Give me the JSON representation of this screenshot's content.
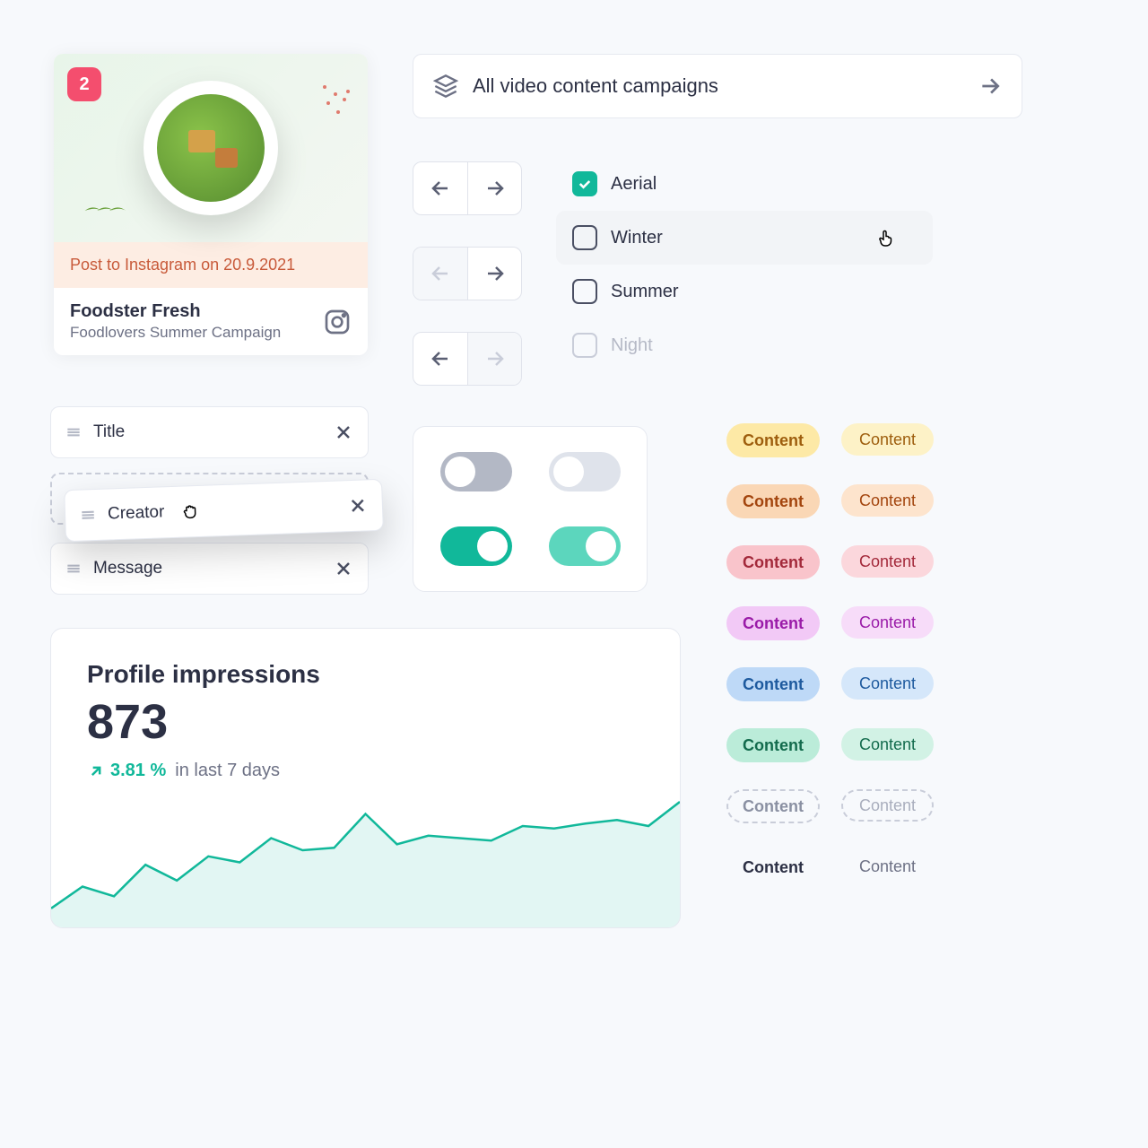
{
  "post": {
    "badge": "2",
    "banner": "Post to Instagram on 20.9.2021",
    "title": "Foodster Fresh",
    "subtitle": "Foodlovers Summer Campaign"
  },
  "campaign_bar": "All video content campaigns",
  "checks": {
    "aerial": "Aerial",
    "winter": "Winter",
    "summer": "Summer",
    "night": "Night"
  },
  "drag": {
    "title": "Title",
    "creator": "Creator",
    "message": "Message"
  },
  "stat": {
    "title": "Profile impressions",
    "value": "873",
    "trend": "3.81 %",
    "period": "in last 7 days"
  },
  "pill_label": "Content",
  "colors": {
    "yellow_bg": "#fde9a6",
    "yellow_fg": "#9e5e0e",
    "yellow_lt": "#fdf2c7",
    "orange_bg": "#fad7b5",
    "orange_fg": "#a3450e",
    "orange_lt": "#fde4cd",
    "pink_bg": "#f9c4cb",
    "pink_fg": "#a3293a",
    "pink_lt": "#fbd7dc",
    "purple_bg": "#f2c9f6",
    "purple_fg": "#9a1ba8",
    "purple_lt": "#f7dcf9",
    "blue_bg": "#bed9f7",
    "blue_fg": "#1e5a9e",
    "blue_lt": "#d5e7fa",
    "green_bg": "#bbecd9",
    "green_fg": "#136b4d",
    "green_lt": "#d2f2e5",
    "gray_fg": "#8a90a2",
    "gray_lt_fg": "#a9aebd",
    "dark_fg": "#2c3044",
    "dark_lt_fg": "#6d7185"
  },
  "chart_data": {
    "type": "line",
    "title": "Profile impressions",
    "ylabel": "",
    "xlabel": "",
    "x": [
      0,
      1,
      2,
      3,
      4,
      5,
      6,
      7,
      8,
      9,
      10,
      11,
      12,
      13,
      14,
      15,
      16,
      17,
      18,
      19,
      20
    ],
    "values": [
      12,
      30,
      22,
      48,
      35,
      55,
      50,
      70,
      60,
      62,
      90,
      65,
      72,
      70,
      68,
      80,
      78,
      82,
      85,
      80,
      100
    ],
    "ylim": [
      0,
      100
    ]
  }
}
